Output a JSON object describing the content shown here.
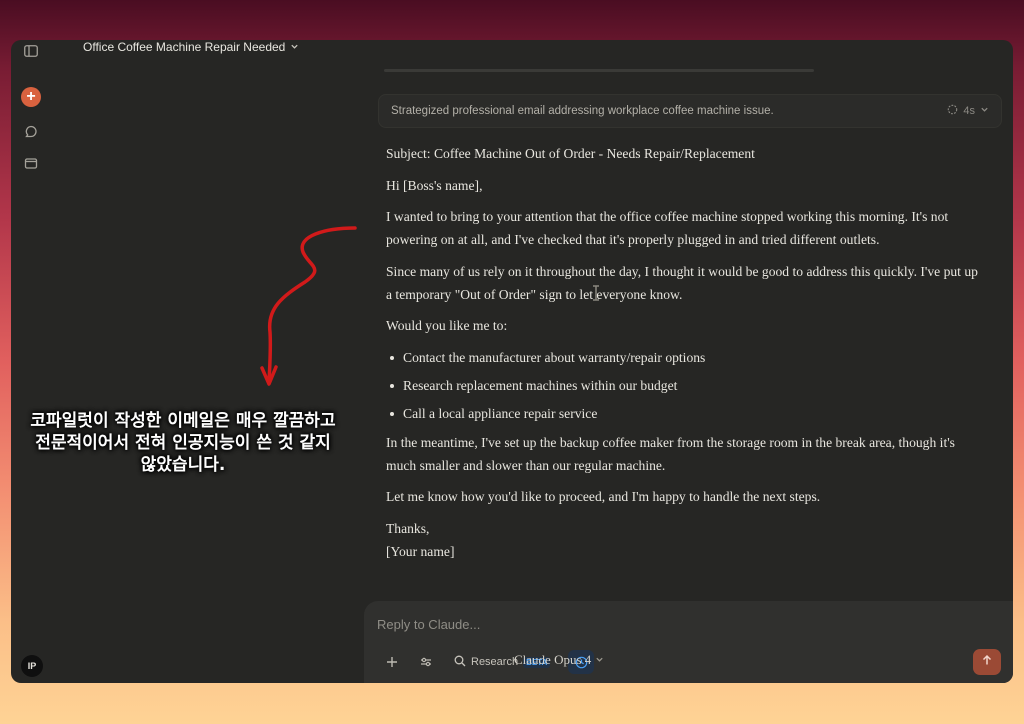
{
  "chat": {
    "title": "Office Coffee Machine Repair Needed"
  },
  "thinking": {
    "summary": "Strategized professional email addressing workplace coffee machine issue.",
    "duration": "4s"
  },
  "message": {
    "subject": "Subject: Coffee Machine Out of Order - Needs Repair/Replacement",
    "greeting": "Hi [Boss's name],",
    "paragraph1": "I wanted to bring to your attention that the office coffee machine stopped working this morning. It's not powering on at all, and I've checked that it's properly plugged in and tried different outlets.",
    "paragraph2": "Since many of us rely on it throughout the day, I thought it would be good to address this quickly. I've put up a temporary \"Out of Order\" sign to let everyone know.",
    "question": "Would you like me to:",
    "options": [
      "Contact the manufacturer about warranty/repair options",
      "Research replacement machines within our budget",
      "Call a local appliance repair service"
    ],
    "paragraph3": "In the meantime, I've set up the backup coffee maker from the storage room in the break area, though it's much smaller and slower than our regular machine.",
    "paragraph4": "Let me know how you'd like to proceed, and I'm happy to handle the next steps.",
    "closing": "Thanks,",
    "signature": "[Your name]"
  },
  "composer": {
    "placeholder": "Reply to Claude...",
    "research_label": "Research",
    "beta_label": "BETA",
    "model": "Claude Opus 4"
  },
  "user": {
    "initials": "IP"
  },
  "overlay": {
    "caption": "코파일럿이 작성한 이메일은 매우 깔끔하고 전문적이어서 전혀 인공지능이 쓴 것 같지 않았습니다."
  },
  "colors": {
    "accent": "#d9623f",
    "send_button": "#9b4a35",
    "panel": "#262624",
    "composer": "#30302e",
    "beta": "#4aa0f5",
    "annotation_arrow": "#d11a1a"
  }
}
